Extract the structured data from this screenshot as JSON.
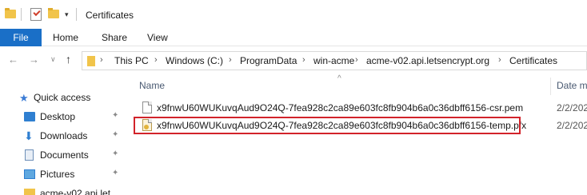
{
  "window": {
    "title": "Certificates",
    "qat_dropdown_glyph": "▾"
  },
  "ribbon": {
    "tabs": [
      "File",
      "Home",
      "Share",
      "View"
    ]
  },
  "nav": {
    "back_glyph": "←",
    "forward_glyph": "→",
    "recent_glyph": "∨",
    "up_glyph": "↑"
  },
  "address": {
    "separator": "›",
    "crumbs": [
      "This PC",
      "Windows (C:)",
      "ProgramData",
      "win-acme",
      "acme-v02.api.letsencrypt.org",
      "Certificates"
    ]
  },
  "sidebar": {
    "items": [
      {
        "label": "Quick access",
        "icon": "star-icon",
        "pinned": false
      },
      {
        "label": "Desktop",
        "icon": "desktop-icon",
        "pinned": true
      },
      {
        "label": "Downloads",
        "icon": "download-icon",
        "pinned": true
      },
      {
        "label": "Documents",
        "icon": "documents-icon",
        "pinned": true
      },
      {
        "label": "Pictures",
        "icon": "pictures-icon",
        "pinned": true
      },
      {
        "label": "acme-v02.api.let",
        "icon": "folder-icon",
        "pinned": false
      }
    ],
    "pin_glyph": "📌"
  },
  "list": {
    "columns": {
      "name": "Name",
      "date": "Date m"
    },
    "sort_glyph": "^",
    "files": [
      {
        "name": "x9fnwU60WUKuvqAud9O24Q-7fea928c2ca89e603fc8fb904b6a0c36dbff6156-csr.pem",
        "date": "2/2/202",
        "icon": "pem-file-icon"
      },
      {
        "name": "x9fnwU60WUKuvqAud9O24Q-7fea928c2ca89e603fc8fb904b6a0c36dbff6156-temp.pfx",
        "date": "2/2/202",
        "icon": "certificate-file-icon"
      }
    ]
  },
  "colors": {
    "accent": "#1a6fc7",
    "highlight": "#d2232a",
    "folder": "#f1c44a"
  }
}
